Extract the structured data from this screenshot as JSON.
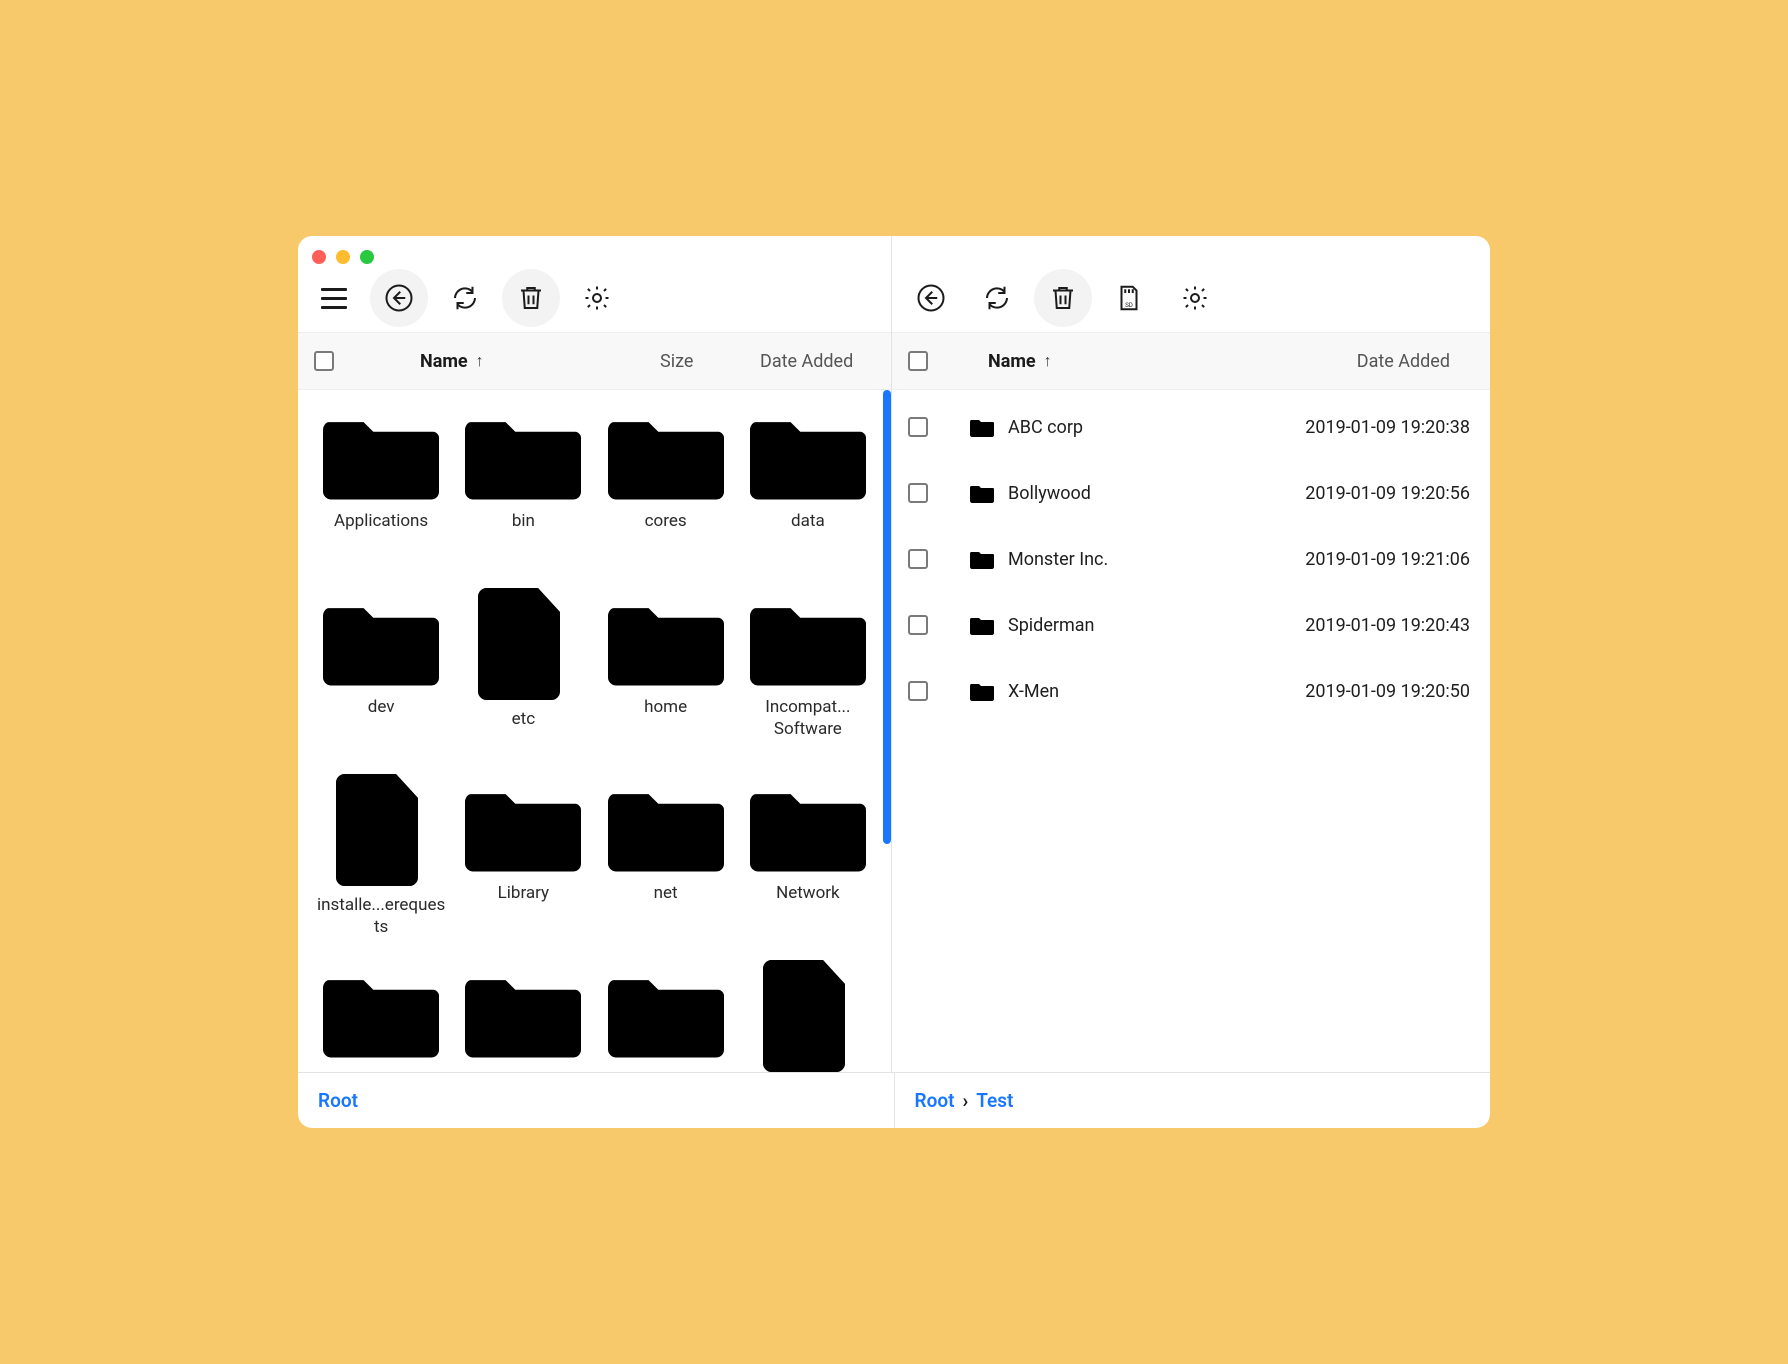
{
  "columns": {
    "name": "Name",
    "size": "Size",
    "date": "Date Added"
  },
  "left": {
    "items": [
      {
        "name": "Applications",
        "type": "folder"
      },
      {
        "name": "bin",
        "type": "folder"
      },
      {
        "name": "cores",
        "type": "folder"
      },
      {
        "name": "data",
        "type": "folder"
      },
      {
        "name": "dev",
        "type": "folder"
      },
      {
        "name": "etc",
        "type": "file"
      },
      {
        "name": "home",
        "type": "folder"
      },
      {
        "name": "Incompat... Software",
        "type": "folder"
      },
      {
        "name": "installe...erequests",
        "type": "file"
      },
      {
        "name": "Library",
        "type": "folder"
      },
      {
        "name": "net",
        "type": "folder"
      },
      {
        "name": "Network",
        "type": "folder"
      },
      {
        "name": "",
        "type": "folder"
      },
      {
        "name": "",
        "type": "folder"
      },
      {
        "name": "",
        "type": "folder"
      },
      {
        "name": "",
        "type": "file"
      }
    ],
    "breadcrumb": [
      "Root"
    ]
  },
  "right": {
    "items": [
      {
        "name": "ABC corp",
        "date": "2019-01-09 19:20:38"
      },
      {
        "name": "Bollywood",
        "date": "2019-01-09 19:20:56"
      },
      {
        "name": "Monster Inc.",
        "date": "2019-01-09 19:21:06"
      },
      {
        "name": "Spiderman",
        "date": "2019-01-09 19:20:43"
      },
      {
        "name": "X-Men",
        "date": "2019-01-09 19:20:50"
      }
    ],
    "breadcrumb": [
      "Root",
      "Test"
    ]
  }
}
